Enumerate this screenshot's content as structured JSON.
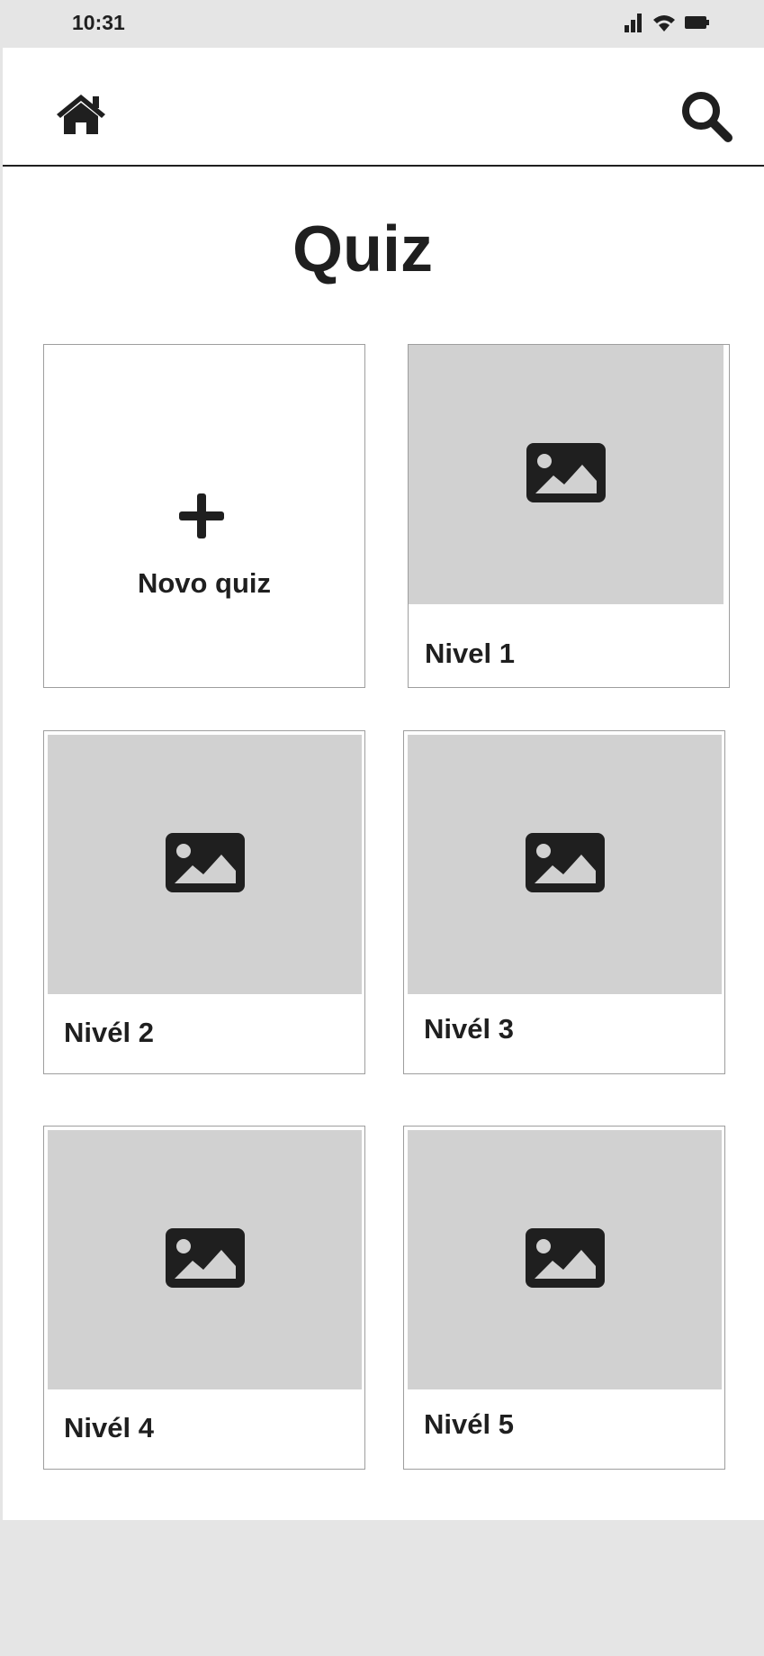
{
  "status_bar": {
    "time": "10:31",
    "icons": [
      "signal-icon",
      "wifi-icon",
      "battery-icon"
    ]
  },
  "app_bar": {
    "left_icon": "home-icon",
    "right_icon": "search-icon"
  },
  "page": {
    "title": "Quiz"
  },
  "new_quiz": {
    "icon": "plus-icon",
    "label": "Novo quiz"
  },
  "quizzes": [
    {
      "label": "Nivel 1",
      "image": "image-placeholder-icon"
    },
    {
      "label": "Nivél 2",
      "image": "image-placeholder-icon"
    },
    {
      "label": "Nivél 3",
      "image": "image-placeholder-icon"
    },
    {
      "label": "Nivél 4",
      "image": "image-placeholder-icon"
    },
    {
      "label": "Nivél 5",
      "image": "image-placeholder-icon"
    }
  ],
  "colors": {
    "background": "#e5e5e5",
    "surface": "#ffffff",
    "placeholder": "#d1d1d1",
    "text": "#1f1f1f",
    "border": "#9e9e9e"
  }
}
